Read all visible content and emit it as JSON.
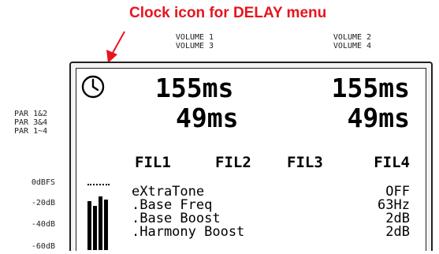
{
  "annotation": {
    "text": "Clock icon for DELAY menu",
    "color": "#e8141e"
  },
  "volume_labels": {
    "left_line1": "VOLUME 1",
    "left_line2": "VOLUME 3",
    "right_line1": "VOLUME 2",
    "right_line2": "VOLUME 4"
  },
  "side_labels": [
    "PAR 1&2",
    "PAR 3&4",
    "PAR 1~4"
  ],
  "db_scale": [
    "0dBFS",
    "-20dB",
    "-40dB",
    "-60dB"
  ],
  "display": {
    "menu_icon": "clock-icon",
    "delays": {
      "top_left": "155ms",
      "top_right": "155ms",
      "bottom_left": "49ms",
      "bottom_right": "49ms"
    },
    "filters": [
      "FIL1",
      "FIL2",
      "FIL3",
      "FIL4"
    ],
    "menu_items": [
      {
        "label": "eXtraTone",
        "value": "OFF"
      },
      {
        "label": ".Base Freq",
        "value": "63Hz"
      },
      {
        "label": ".Base Boost",
        "value": "2dB"
      },
      {
        "label": ".Harmony Boost",
        "value": "2dB"
      }
    ]
  }
}
